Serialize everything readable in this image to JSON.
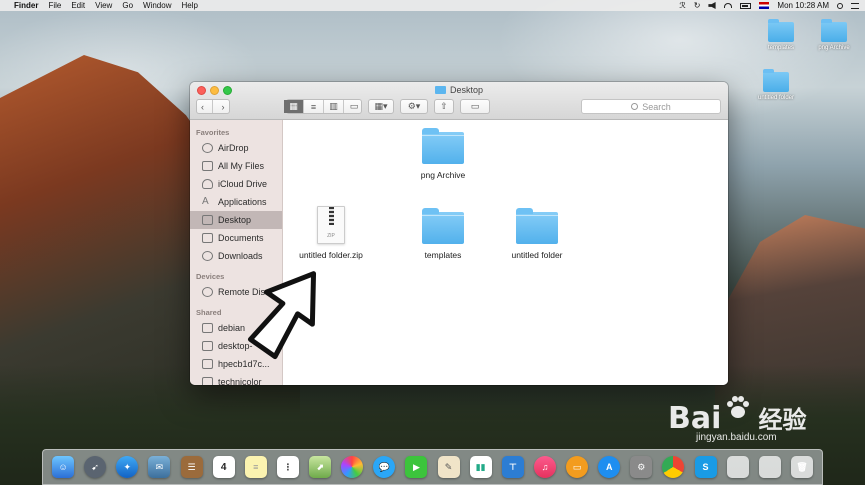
{
  "menubar": {
    "app_name": "Finder",
    "items": [
      "File",
      "Edit",
      "View",
      "Go",
      "Window",
      "Help"
    ],
    "clock": "Mon 10:28 AM"
  },
  "desktop_icons": [
    {
      "label": "templates"
    },
    {
      "label": "png Archive"
    },
    {
      "label": "untitled folder"
    }
  ],
  "window": {
    "title": "Desktop",
    "search_placeholder": "Search"
  },
  "sidebar": {
    "sections": [
      {
        "header": "Favorites",
        "items": [
          {
            "label": "AirDrop",
            "icon": "airdrop-icon"
          },
          {
            "label": "All My Files",
            "icon": "all-files-icon"
          },
          {
            "label": "iCloud Drive",
            "icon": "cloud-icon"
          },
          {
            "label": "Applications",
            "icon": "applications-icon"
          },
          {
            "label": "Desktop",
            "icon": "desktop-icon",
            "selected": true
          },
          {
            "label": "Documents",
            "icon": "documents-icon"
          },
          {
            "label": "Downloads",
            "icon": "downloads-icon"
          }
        ]
      },
      {
        "header": "Devices",
        "items": [
          {
            "label": "Remote Disc",
            "icon": "disc-icon"
          }
        ]
      },
      {
        "header": "Shared",
        "items": [
          {
            "label": "debian",
            "icon": "display-icon"
          },
          {
            "label": "desktop-",
            "icon": "display-icon"
          },
          {
            "label": "hpecb1d7c...",
            "icon": "display-icon"
          },
          {
            "label": "technicolor",
            "icon": "display-icon"
          }
        ]
      }
    ]
  },
  "files": [
    {
      "name": "png Archive",
      "kind": "folder"
    },
    {
      "name": "untitled folder.zip",
      "kind": "zip",
      "badge": "ZIP"
    },
    {
      "name": "templates",
      "kind": "folder"
    },
    {
      "name": "untitled folder",
      "kind": "folder"
    }
  ],
  "dock": {
    "calendar_day": "4"
  },
  "watermark": {
    "brand": "Bai",
    "brand_suffix": "经验",
    "url": "jingyan.baidu.com"
  },
  "colors": {
    "folder": "#52b1ec",
    "selection": "#aaa09e",
    "close": "#fc605b",
    "minimize": "#fdbc40",
    "zoom": "#34c84a"
  }
}
